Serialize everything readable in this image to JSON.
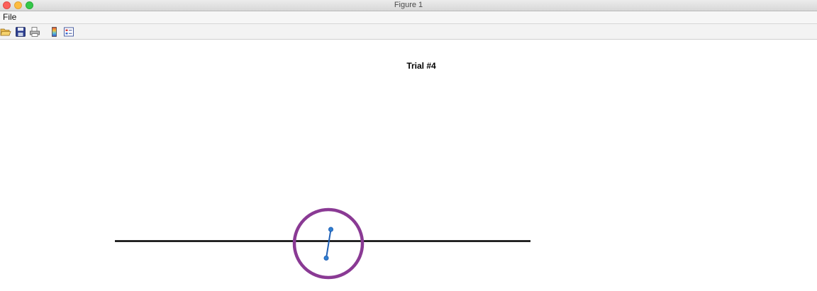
{
  "window": {
    "title": "Figure 1"
  },
  "menubar": {
    "file_label": "File"
  },
  "toolbar": {
    "icons": [
      "open-file-icon",
      "save-icon",
      "print-icon",
      "insert-colorbar-icon",
      "insert-legend-icon"
    ]
  },
  "figure": {
    "title": "Trial #4",
    "colors": {
      "ground_line": "#000000",
      "circle": "#8a3a94",
      "pendulum": "#1f5fb5",
      "pendulum_marker_fill": "#2f7fd0"
    }
  }
}
